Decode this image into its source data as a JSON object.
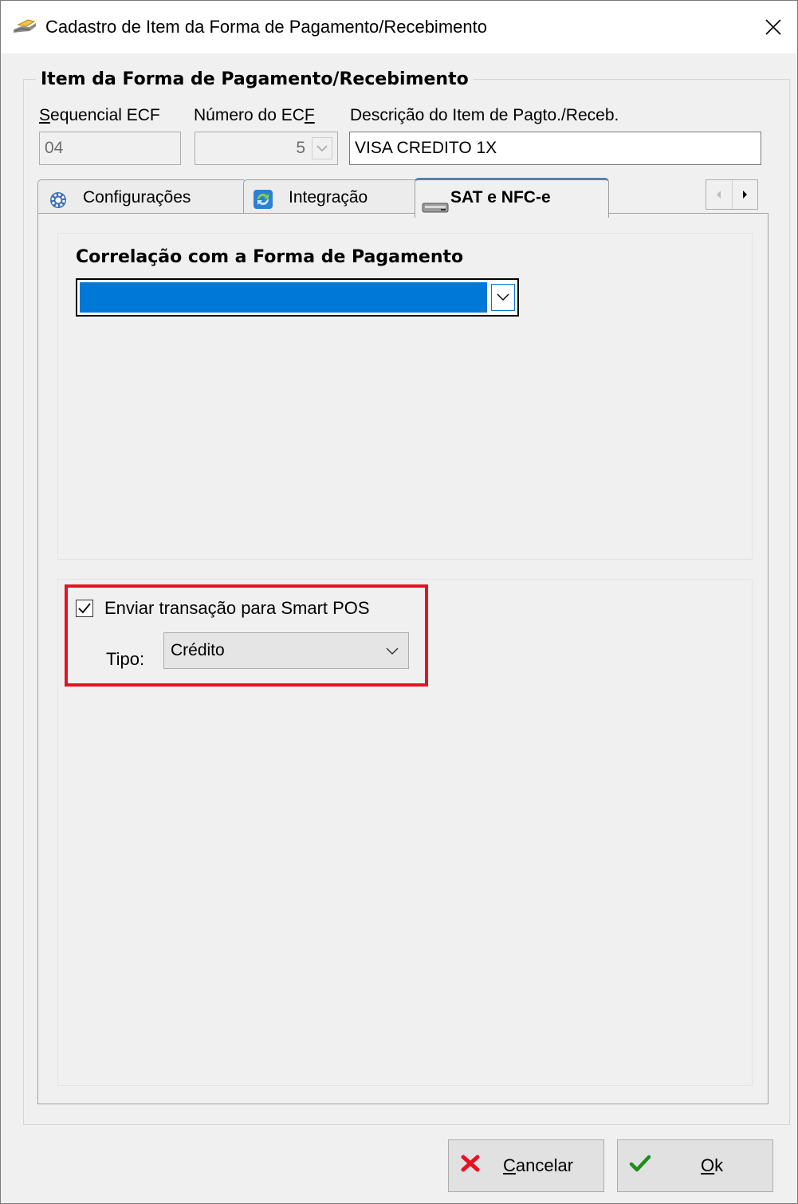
{
  "window": {
    "title": "Cadastro de Item da Forma de Pagamento/Recebimento",
    "close_glyph": "✕"
  },
  "group": {
    "title": "Item da Forma de Pagamento/Recebimento"
  },
  "fields": {
    "sequencial_label_u": "S",
    "sequencial_label_rest": "equencial ECF",
    "sequencial_value": "04",
    "numero_label_pre": "Número do EC",
    "numero_label_u": "F",
    "numero_value": "5",
    "descricao_label": "Descrição do Item de Pagto./Receb.",
    "descricao_value": "VISA CREDITO 1X"
  },
  "tabs": [
    {
      "label": "Configurações",
      "icon": "gear-icon"
    },
    {
      "label": "Integração",
      "icon": "sync-icon"
    },
    {
      "label": "SAT e NFC-e",
      "icon": "printer-device-icon",
      "active": true
    }
  ],
  "sat": {
    "correlacao_title": "Correlação com a Forma de Pagamento",
    "correlacao_value": "",
    "smart_pos_checked": true,
    "smart_pos_label": "Enviar transação para Smart POS",
    "tipo_label": "Tipo:",
    "tipo_value": "Crédito"
  },
  "buttons": {
    "cancel_u": "C",
    "cancel_rest": "ancelar",
    "ok_u": "O",
    "ok_rest": "k"
  },
  "colors": {
    "selection": "#0078d7",
    "highlight": "#e81123",
    "cancel_icon": "#e81123",
    "ok_icon": "#1b8e1b"
  }
}
